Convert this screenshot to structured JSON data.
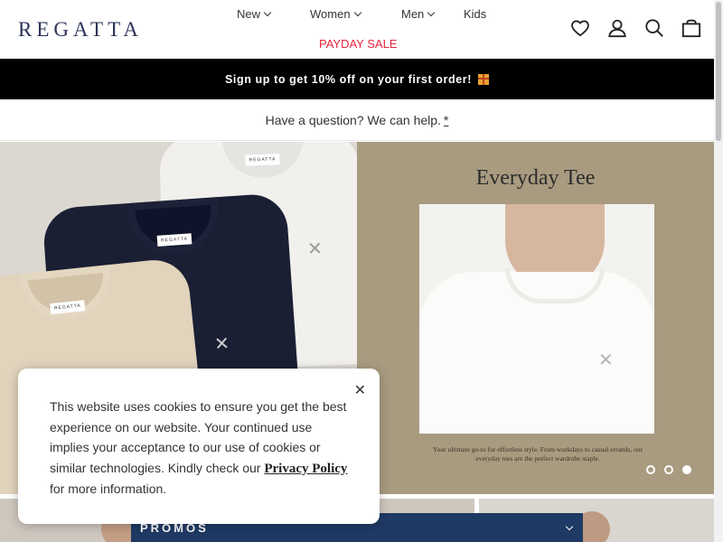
{
  "header": {
    "logo": "REGATTA",
    "nav": [
      {
        "label": "New"
      },
      {
        "label": "Women"
      },
      {
        "label": "Men"
      },
      {
        "label": "Kids"
      }
    ],
    "sale_label": "PAYDAY SALE",
    "icons": [
      "heart-icon",
      "account-icon",
      "search-icon",
      "bag-icon"
    ]
  },
  "announcement": {
    "text": "Sign up to get 10% off on your first order!"
  },
  "help": {
    "text": "Have a question? We can help.",
    "link": "*"
  },
  "hero": {
    "tag_label": "REGATTA",
    "title": "Everyday Tee",
    "caption": "Your ultimate go-to for effortless style. From workdays to casual errands, our everyday tees are the perfect wardrobe staple.",
    "slides": 3,
    "active_slide": 3
  },
  "promos": {
    "label": "PROMOS"
  },
  "cookie": {
    "text": "This website uses cookies to ensure you get the best experience on our website. Your continued use implies your acceptance to our use of cookies or similar technologies. Kindly check our ",
    "link": "Privacy Policy",
    "suffix": " for more information."
  },
  "colors": {
    "brand": "#2d3458",
    "sale": "#e4253b",
    "announce_bg": "#000000",
    "hero_right_bg": "#a99b80",
    "promos_bg": "#1f3a64"
  }
}
